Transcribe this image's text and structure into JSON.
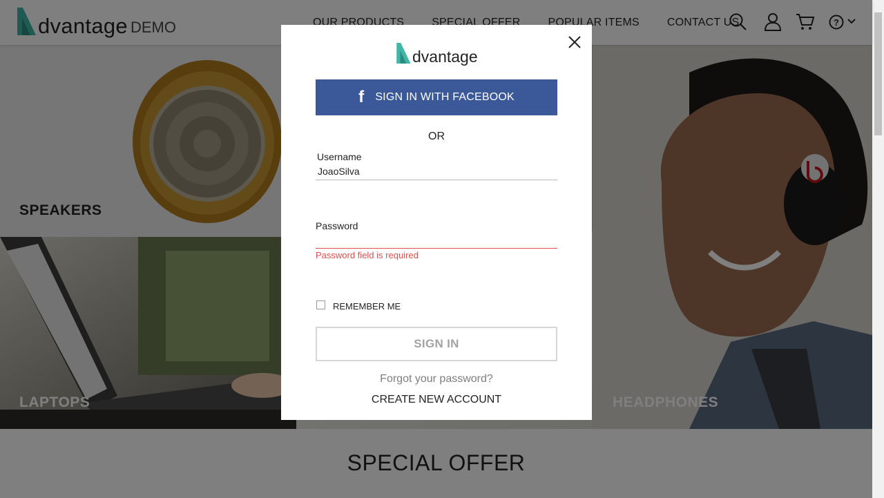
{
  "header": {
    "logo_text": "dvantage",
    "logo_suffix": "DEMO",
    "nav": [
      "OUR PRODUCTS",
      "SPECIAL OFFER",
      "POPULAR ITEMS",
      "CONTACT US"
    ]
  },
  "tiles": {
    "speakers": "SPEAKERS",
    "laptops": "LAPTOPS",
    "headphones": "HEADPHONES"
  },
  "special_offer": {
    "title": "SPECIAL OFFER"
  },
  "login_modal": {
    "logo_text": "dvantage",
    "facebook_button": "SIGN IN WITH FACEBOOK",
    "or_text": "OR",
    "username": {
      "label": "Username",
      "value": "JoaoSilva"
    },
    "password": {
      "label": "Password",
      "value": "",
      "error": "Password field is required"
    },
    "remember_me": {
      "label": "REMEMBER ME",
      "checked": false
    },
    "signin_button": "SIGN IN",
    "forgot_password": "Forgot your password?",
    "create_account": "CREATE NEW ACCOUNT"
  },
  "colors": {
    "accent": "#3fb7a7",
    "facebook": "#3b5998",
    "error": "#e04d4d",
    "overlay": "rgba(0,0,0,0.5)"
  },
  "icons": [
    "search-icon",
    "user-icon",
    "cart-icon",
    "help-icon",
    "chevron-down-icon",
    "close-icon",
    "facebook-icon"
  ]
}
